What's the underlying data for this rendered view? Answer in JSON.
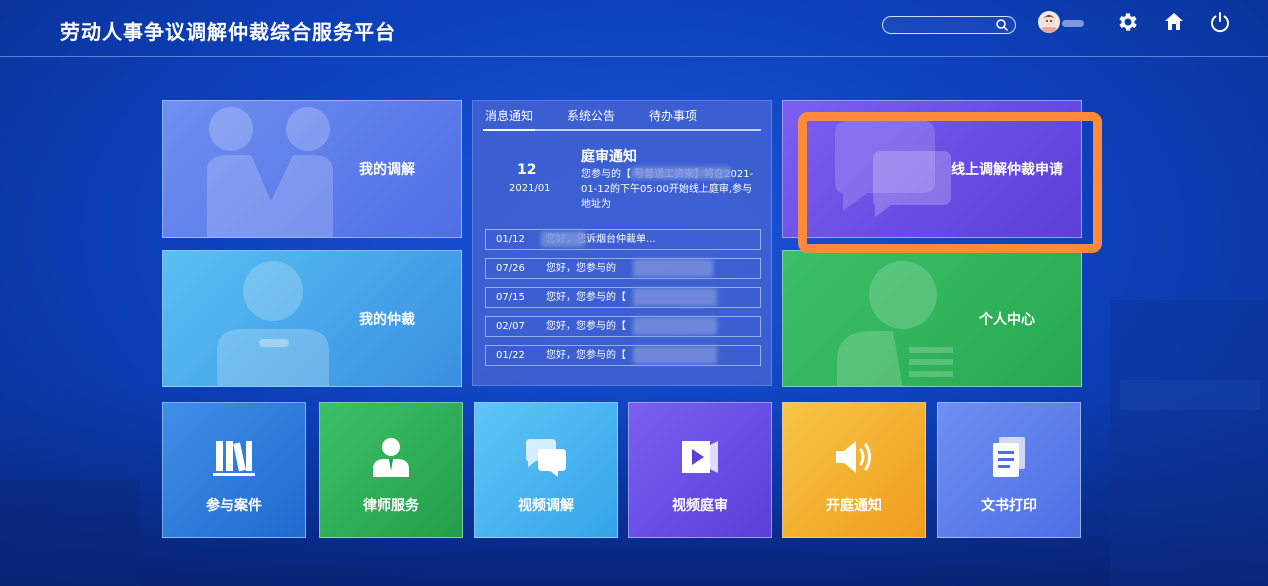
{
  "header": {
    "title": "劳动人事争议调解仲裁综合服务平台",
    "search_placeholder": ""
  },
  "tiles": {
    "my_mediation": "我的调解",
    "my_arbitration": "我的仲裁",
    "online_apply": "线上调解仲裁申请",
    "personal_center": "个人中心"
  },
  "news": {
    "tabs": [
      "消息通知",
      "系统公告",
      "待办事项"
    ],
    "featured": {
      "day": "12",
      "year_month": "2021/01",
      "title": "庭审通知",
      "body": "您参与的【 号普通工资案】将在2021-01-12的下午05:00开始线上庭审,参与地址为"
    },
    "items": [
      {
        "date": "01/12",
        "text": "您好，您诉烟台仲裁单..."
      },
      {
        "date": "07/26",
        "text": "您好，您参与的"
      },
      {
        "date": "07/15",
        "text": "您好，您参与的【"
      },
      {
        "date": "02/07",
        "text": "您好，您参与的【"
      },
      {
        "date": "01/22",
        "text": "您好，您参与的【"
      }
    ]
  },
  "services": [
    "参与案件",
    "律师服务",
    "视频调解",
    "视频庭审",
    "开庭通知",
    "文书打印"
  ]
}
